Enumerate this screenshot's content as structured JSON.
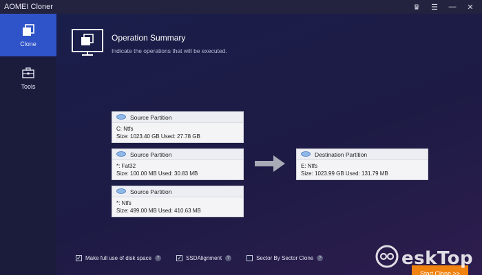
{
  "app": {
    "title": "AOMEI Cloner"
  },
  "window_controls": [
    {
      "name": "crown-icon",
      "glyph": "♛"
    },
    {
      "name": "menu-icon",
      "glyph": "☰"
    },
    {
      "name": "minimize-icon",
      "glyph": "—"
    },
    {
      "name": "close-icon",
      "glyph": "✕"
    }
  ],
  "sidebar": {
    "items": [
      {
        "label": "Clone",
        "icon": "clone-icon",
        "active": true
      },
      {
        "label": "Tools",
        "icon": "toolbox-icon",
        "active": false
      }
    ]
  },
  "summary": {
    "title": "Operation Summary",
    "subtitle": "Indicate the operations that will be executed."
  },
  "sources": [
    {
      "header": "Source Partition",
      "line1": "C: Ntfs",
      "line2": "Size: 1023.40 GB  Used: 27.78 GB"
    },
    {
      "header": "Source Partition",
      "line1": "*: Fat32",
      "line2": "Size: 100.00 MB  Used: 30.83 MB"
    },
    {
      "header": "Source Partition",
      "line1": "*: Ntfs",
      "line2": "Size: 499.00 MB  Used: 410.63 MB"
    }
  ],
  "destination": {
    "header": "Destination Partition",
    "line1": "E: Ntfs",
    "line2": "Size: 1023.99 GB  Used: 131.79 MB"
  },
  "options": [
    {
      "label": "Make full use of disk space",
      "checked": true
    },
    {
      "label": "SSDAlignment",
      "checked": true
    },
    {
      "label": "Sector By Sector Clone",
      "checked": false
    }
  ],
  "start_button": {
    "label": "Start Clone >>"
  },
  "watermark": {
    "text": "eskTop"
  },
  "colors": {
    "accent": "#2f54c9",
    "start": "#f0820f"
  }
}
